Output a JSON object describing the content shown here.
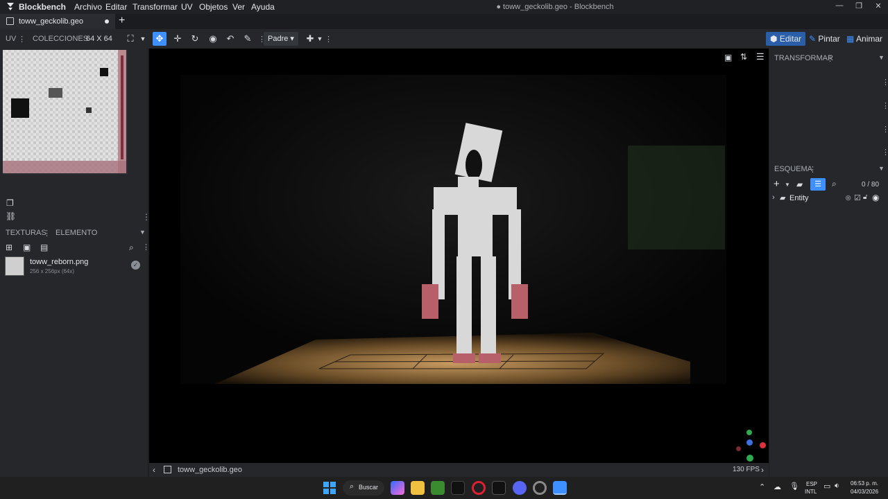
{
  "app": {
    "name": "Blockbench",
    "window_title": "● toww_geckolib.geo - Blockbench"
  },
  "menu": [
    "Archivo",
    "Editar",
    "Transformar",
    "UV",
    "Objetos",
    "Ver",
    "Ayuda"
  ],
  "tabs": [
    {
      "label": "toww_geckolib.geo",
      "modified": true
    }
  ],
  "toolbar": {
    "uv_label": "UV",
    "collections_label": "COLECCIONES",
    "uv_size": "64 X 64",
    "pivot_select": "Padre",
    "modes": [
      "Editar",
      "Pintar",
      "Animar"
    ]
  },
  "left_panel": {
    "textures_tab": "TEXTURAS",
    "element_tab": "ELEMENTO",
    "textures": [
      {
        "name": "toww_reborn.png",
        "meta": "256 x 256px (64x)"
      }
    ]
  },
  "right_panel": {
    "transform_title": "TRANSFORMAR",
    "outliner_title": "ESQUEMA",
    "outliner_count": "0 / 80",
    "outliner_items": [
      {
        "label": "Entity"
      }
    ]
  },
  "statusbar": {
    "file": "toww_geckolib.geo",
    "fps": "130 FPS"
  },
  "taskbar": {
    "search_label": "Buscar",
    "lang_top": "ESP",
    "lang_bottom": "INTL",
    "time": "06:53 p. m.",
    "date": "04/03/2026"
  },
  "colors": {
    "accent": "#3e90ff",
    "active_mode": "#2b5ea8",
    "panel_bg": "#25272b",
    "viewport_bg": "#000000"
  }
}
